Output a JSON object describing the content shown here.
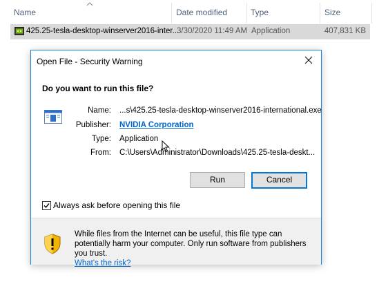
{
  "explorer": {
    "columns": {
      "name": "Name",
      "date": "Date modified",
      "type": "Type",
      "size": "Size"
    },
    "file": {
      "name": "425.25-tesla-desktop-winserver2016-inter...",
      "date": "3/30/2020 11:49 AM",
      "type": "Application",
      "size": "407,831 KB",
      "icon": "nvidia-app-icon"
    }
  },
  "dialog": {
    "title": "Open File - Security Warning",
    "question": "Do you want to run this file?",
    "fields": {
      "name_label": "Name:",
      "name_value": "...s\\425.25-tesla-desktop-winserver2016-international.exe",
      "publisher_label": "Publisher:",
      "publisher_value": "NVIDIA Corporation",
      "type_label": "Type:",
      "type_value": "Application",
      "from_label": "From:",
      "from_value": "C:\\Users\\Administrator\\Downloads\\425.25-tesla-deskt..."
    },
    "buttons": {
      "run": "Run",
      "cancel": "Cancel"
    },
    "checkbox": {
      "label": "Always ask before opening this file",
      "checked": true
    },
    "warning": {
      "text": "While files from the Internet can be useful, this file type can potentially harm your computer. Only run software from publishers you trust.",
      "link": "What's the risk?"
    }
  },
  "colors": {
    "accent": "#0078d7",
    "link": "#0066cc",
    "selection": "#d9d9d9",
    "footer": "#f0f0f0"
  }
}
